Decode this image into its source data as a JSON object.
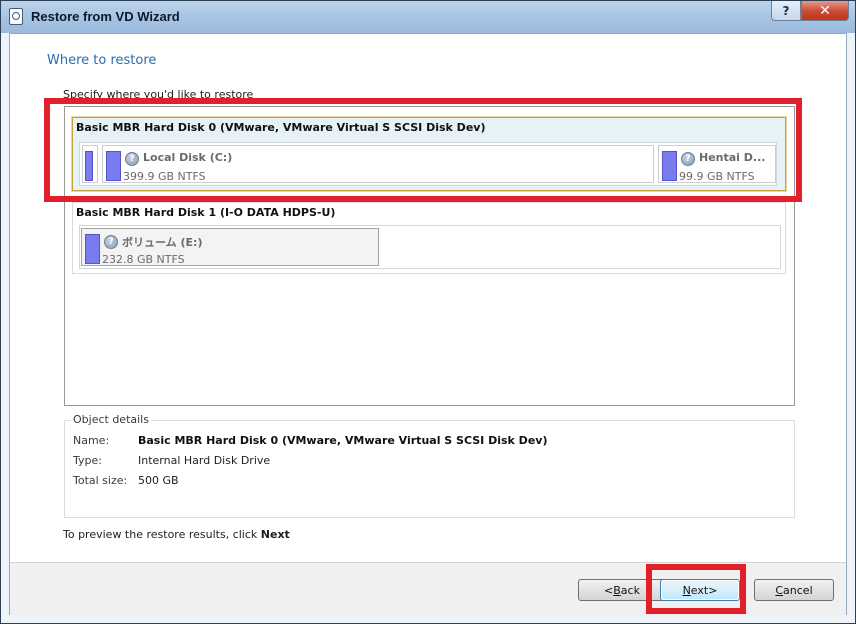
{
  "window": {
    "title": "Restore from VD Wizard",
    "help_glyph": "?",
    "close_glyph": "✕"
  },
  "page": {
    "heading": "Where to restore",
    "instruction": "Specify where you'd like to restore"
  },
  "disks": [
    {
      "title": "Basic MBR Hard Disk 0 (VMware, VMware Virtual S SCSI Disk Dev)",
      "selected": true,
      "partitions": [
        {
          "name": "",
          "info": ""
        },
        {
          "name": "Local Disk (C:)",
          "info": "399.9 GB NTFS"
        },
        {
          "name": "Hentai D...",
          "info": "99.9 GB NTFS"
        }
      ]
    },
    {
      "title": "Basic MBR Hard Disk 1 (I-O DATA HDPS-U)",
      "selected": false,
      "partitions": [
        {
          "name": "ボリューム (E:)",
          "info": "232.8 GB NTFS"
        }
      ]
    }
  ],
  "details": {
    "legend": "Object details",
    "name_label": "Name:",
    "name_value": "Basic MBR Hard Disk 0 (VMware, VMware Virtual S SCSI Disk Dev)",
    "type_label": "Type:",
    "type_value": "Internal Hard Disk Drive",
    "size_label": "Total size:",
    "size_value": "500 GB"
  },
  "hint": {
    "prefix": "To preview the restore results, click ",
    "action": "Next"
  },
  "buttons": {
    "back": {
      "lt": "< ",
      "key": "B",
      "rest": "ack"
    },
    "next": {
      "key": "N",
      "rest": "ext",
      "gt": " >"
    },
    "cancel": {
      "key": "C",
      "rest": "ancel"
    }
  },
  "colors": {
    "accent": "#2b6cae",
    "highlight_box": "#e0202a",
    "partition_bar": "#7b7bf0"
  }
}
